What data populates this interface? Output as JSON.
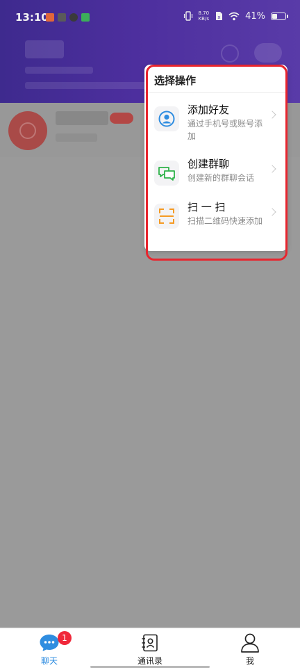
{
  "status_bar": {
    "time": "13:10",
    "net_speed_value": "8.70",
    "net_speed_unit": "KB/s",
    "battery_percent": "41%",
    "battery_level": 0.41
  },
  "popup": {
    "title": "选择操作",
    "items": [
      {
        "label": "添加好友",
        "description": "通过手机号或账号添加",
        "icon": "person-icon"
      },
      {
        "label": "创建群聊",
        "description": "创建新的群聊会话",
        "icon": "chat-bubbles-icon"
      },
      {
        "label": "扫 一 扫",
        "description": "扫描二维码快速添加",
        "icon": "scan-icon"
      }
    ]
  },
  "bottom_nav": {
    "items": [
      {
        "label": "聊天",
        "icon": "chat-icon",
        "active": true,
        "badge": "1"
      },
      {
        "label": "通讯录",
        "icon": "contacts-icon",
        "active": false
      },
      {
        "label": "我",
        "icon": "profile-icon",
        "active": false
      }
    ]
  },
  "colors": {
    "accent": "#2f8de0",
    "badge": "#f0283a",
    "highlight": "#e8252e",
    "header_gradient_start": "#3e2a8e",
    "header_gradient_end": "#593ba8"
  }
}
